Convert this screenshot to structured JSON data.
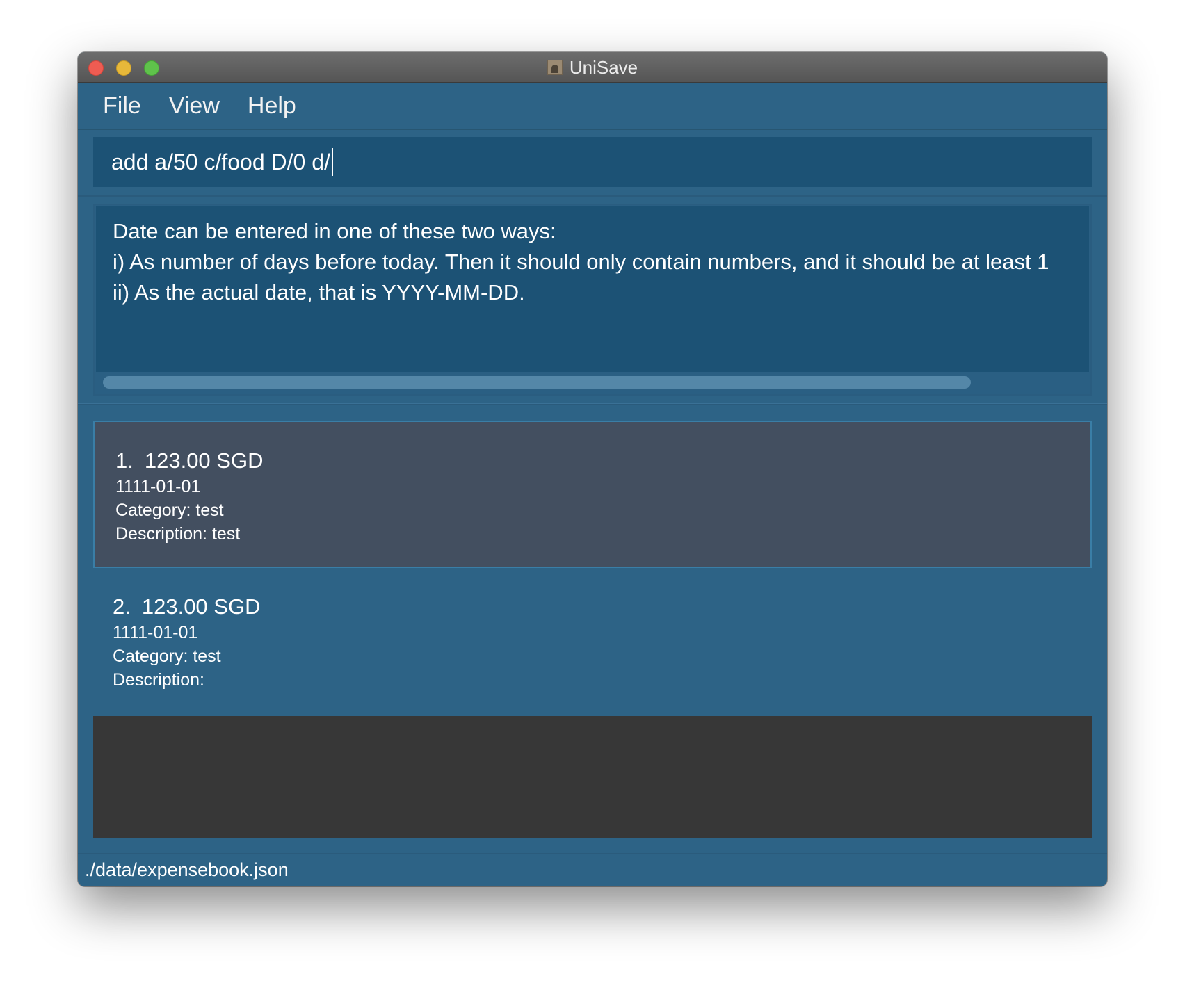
{
  "window": {
    "title": "UniSave",
    "app_icon": "user-icon"
  },
  "menu": {
    "items": [
      "File",
      "View",
      "Help"
    ]
  },
  "command": {
    "value": "add a/50 c/food D/0 d/"
  },
  "result": {
    "lines": [
      "Date can be entered in one of these two ways:",
      "i) As number of days before today. Then it should only contain numbers, and it should be at least 1",
      "ii) As the actual date, that is YYYY-MM-DD."
    ]
  },
  "expenses": [
    {
      "index": "1.",
      "amount": "123.00 SGD",
      "date": "1111-01-01",
      "category": "Category: test",
      "description": "Description: test"
    },
    {
      "index": "2.",
      "amount": "123.00 SGD",
      "date": "1111-01-01",
      "category": "Category: test",
      "description": "Description:"
    }
  ],
  "status": {
    "path": "./data/expensebook.json"
  },
  "colors": {
    "background": "#2d6386",
    "input": "#1c5275",
    "selected_card": "#434f60",
    "dark_panel": "#373737"
  }
}
